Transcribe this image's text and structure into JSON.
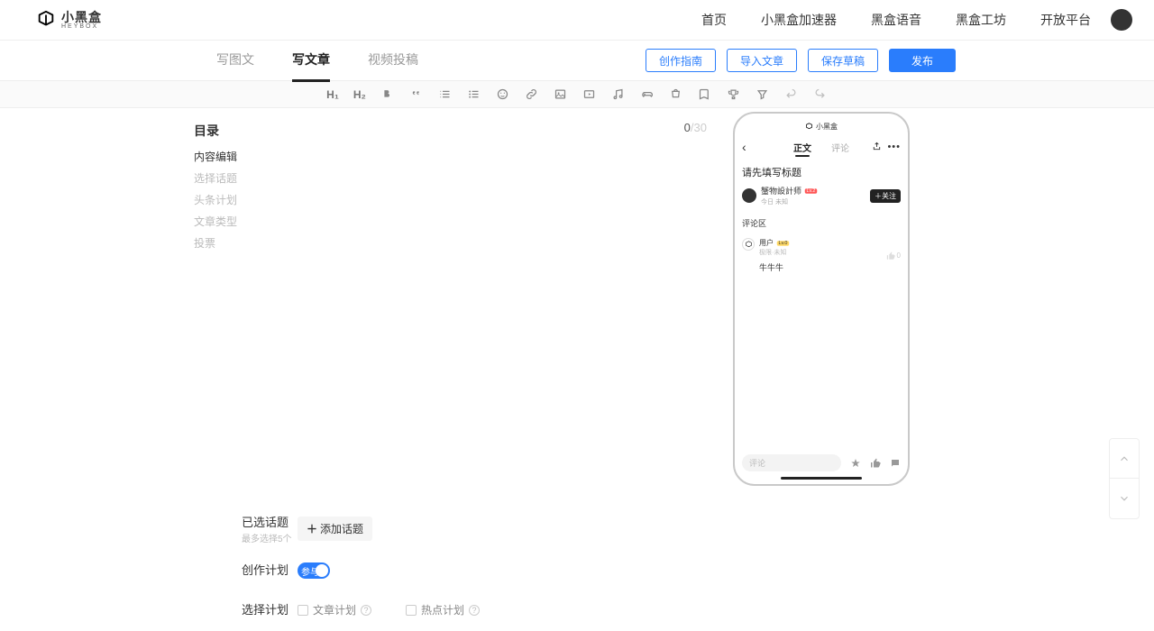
{
  "header": {
    "logo_cn": "小黑盒",
    "logo_en": "HEYBOX",
    "nav": [
      "首页",
      "小黑盒加速器",
      "黑盒语音",
      "黑盒工坊",
      "开放平台"
    ]
  },
  "sub_tabs": [
    "写图文",
    "写文章",
    "视频投稿"
  ],
  "sub_active": 1,
  "actions": {
    "guide": "创作指南",
    "import": "导入文章",
    "draft": "保存草稿",
    "publish": "发布"
  },
  "toolbar": {
    "h1": "H₁",
    "h2": "H₂"
  },
  "sidebar": {
    "title": "目录",
    "items": [
      "内容编辑",
      "选择话题",
      "头条计划",
      "文章类型",
      "投票"
    ]
  },
  "title_counter": {
    "cur": "0",
    "max": "30"
  },
  "topics": {
    "label": "已选话题",
    "hint": "最多选择5个",
    "add": "添加话题"
  },
  "plan": {
    "label": "创作计划",
    "toggle": "参与"
  },
  "select_plan": {
    "label": "选择计划",
    "opt1": "文章计划",
    "opt2": "热点计划"
  },
  "phone": {
    "brand": "小黑盒",
    "tab_main": "正文",
    "tab_comment": "评论",
    "title_placeholder": "请先填写标题",
    "author": "蟹物設計师",
    "author_badge": "Lv.2",
    "author_date": "今日 未知",
    "follow": "＋关注",
    "comment_section": "评论区",
    "user": "用户",
    "user_badge": "Lv.0",
    "user_date": "极限·未知",
    "comment_text": "牛牛牛",
    "likes": "0",
    "comment_input": "评论"
  }
}
